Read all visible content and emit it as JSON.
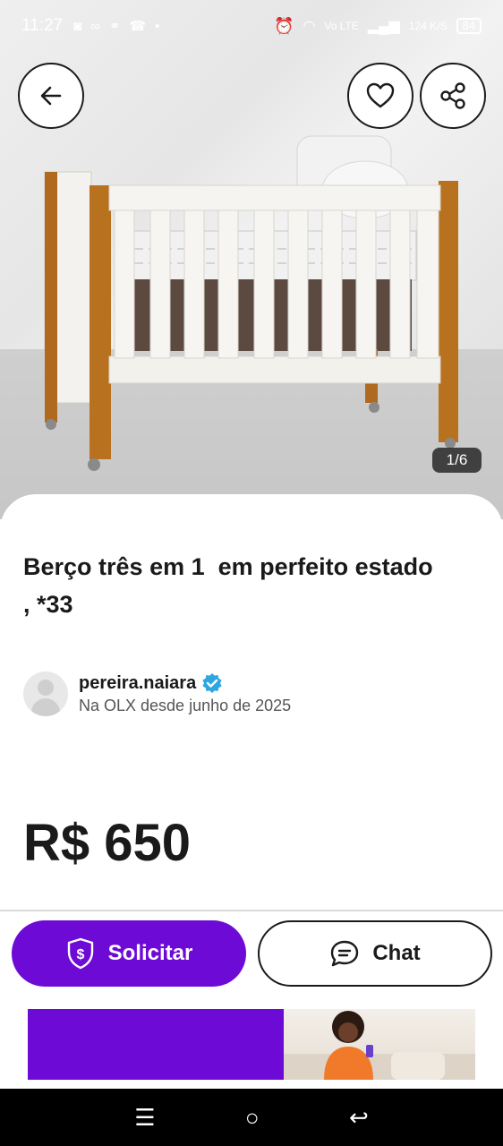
{
  "status_bar": {
    "time": "11:27",
    "network": "Vo LTE",
    "speed": "124 K/S",
    "battery": "84"
  },
  "gallery": {
    "counter": "1/6"
  },
  "listing": {
    "title": "Berço três em 1  em perfeito estado , *33",
    "price": "R$ 650"
  },
  "seller": {
    "name": "pereira.naiara",
    "since": "Na OLX desde junho de 2025",
    "verified": true
  },
  "actions": {
    "solicitar_label": "Solicitar",
    "chat_label": "Chat"
  },
  "colors": {
    "brand_purple": "#6e0ad6",
    "verified_blue": "#2ea7e0"
  },
  "icons": [
    "back-arrow-icon",
    "heart-icon",
    "share-icon",
    "shield-dollar-icon",
    "chat-bubble-icon",
    "verified-badge-icon"
  ]
}
